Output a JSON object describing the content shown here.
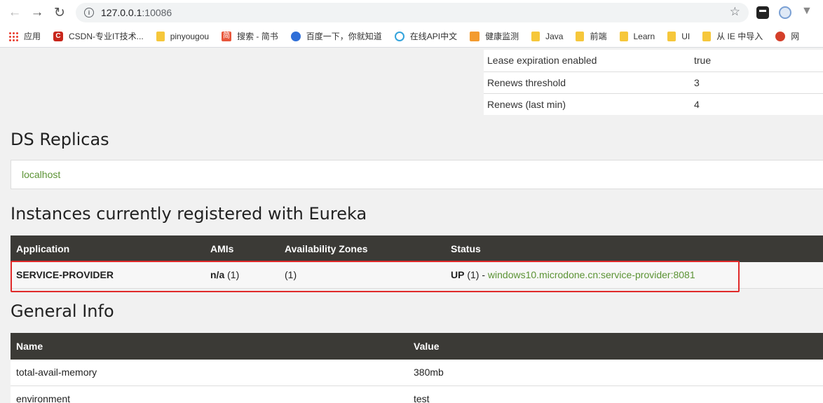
{
  "browser": {
    "url_host": "127.0.0.1",
    "url_port": ":10086"
  },
  "bookmarks": [
    {
      "label": "应用",
      "icon": "apps-grid-icon"
    },
    {
      "label": "CSDN-专业IT技术...",
      "icon": "csdn-icon"
    },
    {
      "label": "pinyougou",
      "icon": "folder-icon"
    },
    {
      "label": "搜索 - 简书",
      "icon": "jianshu-icon"
    },
    {
      "label": "百度一下，你就知道",
      "icon": "baidu-paw-icon"
    },
    {
      "label": "在线API中文",
      "icon": "api-icon"
    },
    {
      "label": "健康监测",
      "icon": "health-icon"
    },
    {
      "label": "Java",
      "icon": "folder-icon"
    },
    {
      "label": "前端",
      "icon": "folder-icon"
    },
    {
      "label": "Learn",
      "icon": "folder-icon"
    },
    {
      "label": "UI",
      "icon": "folder-icon"
    },
    {
      "label": "从 IE 中导入",
      "icon": "folder-icon"
    },
    {
      "label": "网",
      "icon": "net-icon"
    }
  ],
  "lease": [
    {
      "name": "Lease expiration enabled",
      "value": "true"
    },
    {
      "name": "Renews threshold",
      "value": "3"
    },
    {
      "name": "Renews (last min)",
      "value": "4"
    }
  ],
  "ds_replicas": {
    "title": "DS Replicas",
    "link": "localhost"
  },
  "instances": {
    "title": "Instances currently registered with Eureka",
    "headers": [
      "Application",
      "AMIs",
      "Availability Zones",
      "Status"
    ],
    "rows": [
      {
        "application": "SERVICE-PROVIDER",
        "amis_bold": "n/a",
        "amis_count": " (1)",
        "zones": "(1)",
        "status_bold": "UP",
        "status_count": " (1) - ",
        "status_link": "windows10.microdone.cn:service-provider:8081"
      }
    ]
  },
  "general_info": {
    "title": "General Info",
    "headers": [
      "Name",
      "Value"
    ],
    "rows": [
      {
        "name": "total-avail-memory",
        "value": "380mb"
      },
      {
        "name": "environment",
        "value": "test"
      }
    ]
  },
  "colors": {
    "header_bg": "#3b3a36",
    "link_green": "#5b9334",
    "highlight_red": "#e02a2a"
  }
}
